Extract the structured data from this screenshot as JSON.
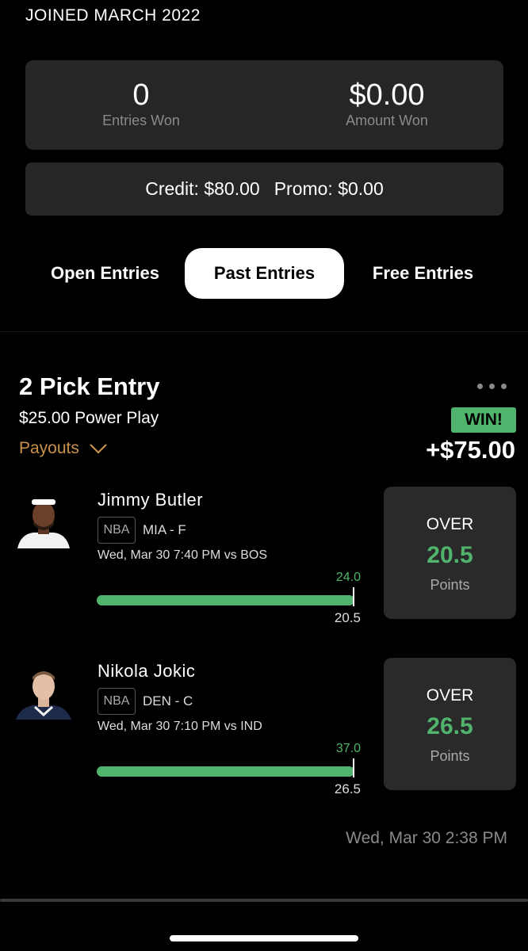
{
  "profile": {
    "joined": "JOINED MARCH 2022"
  },
  "stats": {
    "entries_won": {
      "value": "0",
      "label": "Entries Won"
    },
    "amount_won": {
      "value": "$0.00",
      "label": "Amount Won"
    }
  },
  "balance": {
    "credit": "Credit: $80.00",
    "promo": "Promo: $0.00"
  },
  "tabs": [
    {
      "label": "Open Entries",
      "active": false
    },
    {
      "label": "Past Entries",
      "active": true
    },
    {
      "label": "Free Entries",
      "active": false
    }
  ],
  "entry": {
    "title": "2 Pick Entry",
    "subtitle": "$25.00 Power Play",
    "payouts_label": "Payouts",
    "result_badge": "WIN!",
    "result_amount": "+$75.00",
    "timestamp": "Wed, Mar 30 2:38 PM",
    "picks": [
      {
        "player": "Jimmy Butler",
        "league": "NBA",
        "team_pos": "MIA - F",
        "game": "Wed, Mar 30 7:40 PM  vs BOS",
        "actual": "24.0",
        "line": "20.5",
        "direction": "OVER",
        "stat": "Points",
        "progress": 1.0
      },
      {
        "player": "Nikola Jokic",
        "league": "NBA",
        "team_pos": "DEN - C",
        "game": "Wed, Mar 30 7:10 PM  vs IND",
        "actual": "37.0",
        "line": "26.5",
        "direction": "OVER",
        "stat": "Points",
        "progress": 1.0
      }
    ]
  },
  "colors": {
    "accent_green": "#50b46c",
    "payouts_gold": "#c8914a",
    "card_bg": "#262626"
  }
}
